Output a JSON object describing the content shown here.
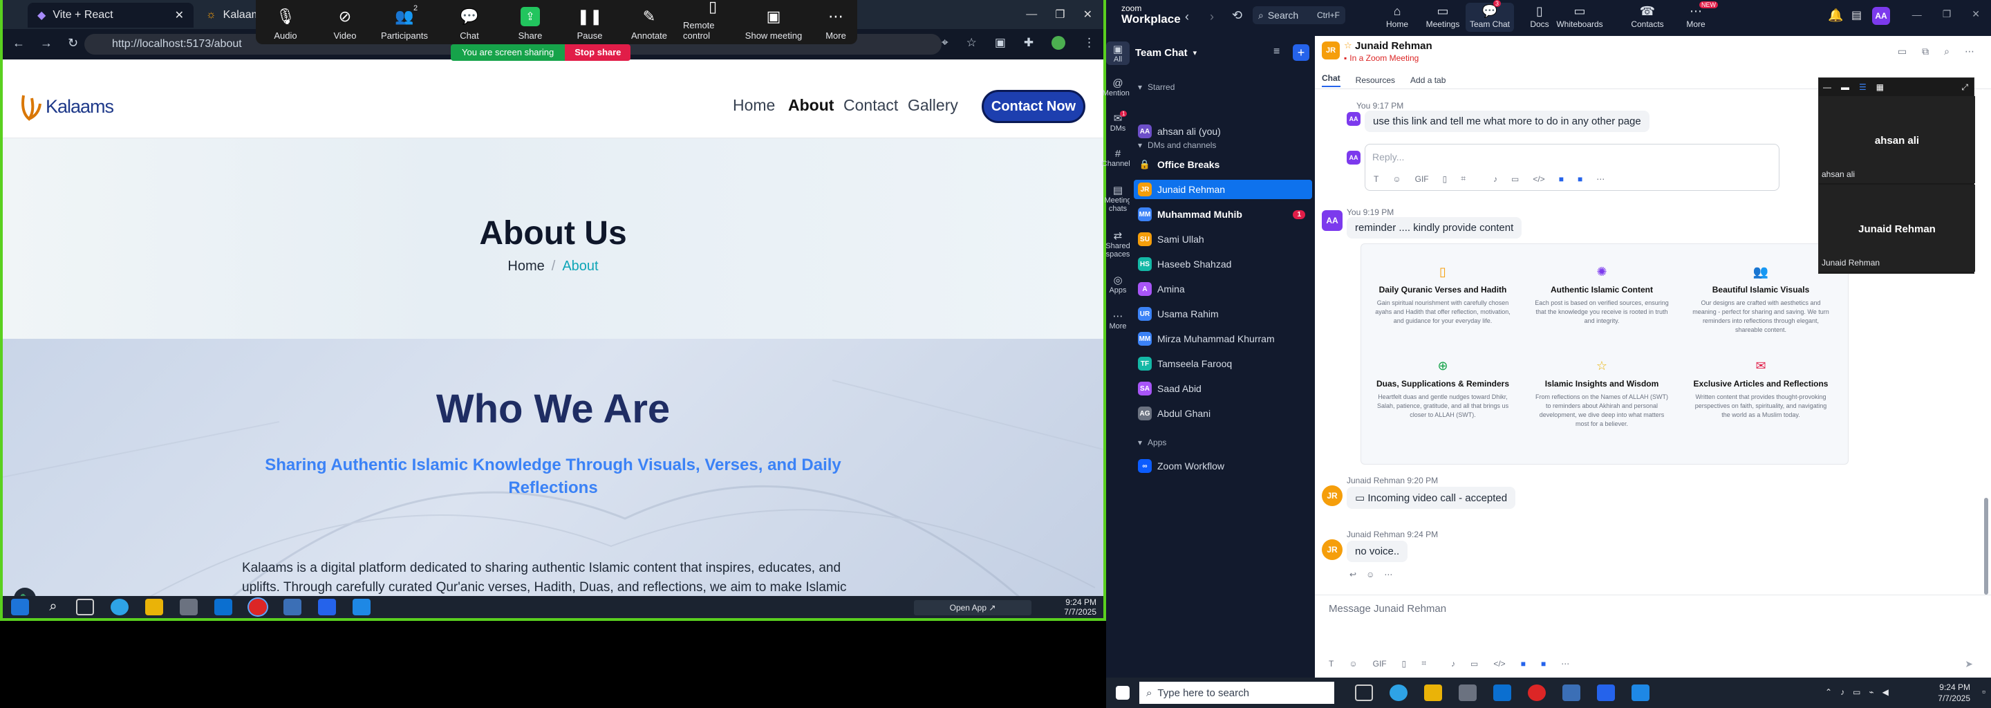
{
  "browser": {
    "tabs": [
      {
        "title": "Vite + React"
      },
      {
        "title": "Kalaams"
      }
    ],
    "url": "http://localhost:5173/about"
  },
  "zoom_toolbar": {
    "items": [
      {
        "label": "Audio",
        "icon": "microphone-icon"
      },
      {
        "label": "Video",
        "icon": "video-off-icon"
      },
      {
        "label": "Participants",
        "icon": "participants-icon",
        "count": "2"
      },
      {
        "label": "Chat",
        "icon": "chat-icon"
      },
      {
        "label": "Share",
        "icon": "share-icon"
      },
      {
        "label": "Pause",
        "icon": "pause-icon"
      },
      {
        "label": "Annotate",
        "icon": "annotate-icon"
      },
      {
        "label": "Remote control",
        "icon": "remote-control-icon"
      },
      {
        "label": "Show meeting",
        "icon": "show-meeting-icon"
      },
      {
        "label": "More",
        "icon": "more-icon"
      }
    ],
    "sharing_text": "You are screen sharing",
    "stop_share": "Stop share"
  },
  "site": {
    "logo": "Kalaams",
    "nav": [
      "Home",
      "About",
      "Contact",
      "Gallery"
    ],
    "active_nav": "About",
    "cta": "Contact Now",
    "hero_title": "About Us",
    "breadcrumb_home": "Home",
    "breadcrumb_sep": "/",
    "breadcrumb_current": "About",
    "who_title": "Who We Are",
    "who_subtitle": "Sharing Authentic Islamic Knowledge Through Visuals, Verses, and Daily Reflections",
    "body_line1": "Kalaams is a digital platform dedicated to sharing authentic Islamic content that inspires, educates, and",
    "body_line2": "uplifts. Through carefully curated Qur'anic verses, Hadith, Duas, and reflections, we aim to make Islamic"
  },
  "left_taskbar": {
    "open_app": "Open App ↗",
    "time": "9:24 PM",
    "date": "7/7/2025"
  },
  "zoom": {
    "brand_top": "zoom",
    "brand": "Workplace",
    "search": "Search",
    "search_shortcut": "Ctrl+F",
    "nav": [
      {
        "label": "Home",
        "icon": "home-icon"
      },
      {
        "label": "Meetings",
        "icon": "meetings-icon"
      },
      {
        "label": "Team Chat",
        "icon": "team-chat-icon",
        "badge": "3"
      },
      {
        "label": "Docs",
        "icon": "docs-icon"
      },
      {
        "label": "Whiteboards",
        "icon": "whiteboards-icon"
      },
      {
        "label": "Contacts",
        "icon": "contacts-icon"
      },
      {
        "label": "More",
        "icon": "more-icon",
        "badge": "NEW"
      }
    ],
    "avatar": "AA",
    "rail": [
      {
        "label": "All"
      },
      {
        "label": "Mentions"
      },
      {
        "label": "DMs",
        "badge": "1"
      },
      {
        "label": "Channels"
      },
      {
        "label": "Meeting chats"
      },
      {
        "label": "Shared spaces"
      },
      {
        "label": "Apps"
      },
      {
        "label": "More"
      }
    ],
    "sidebar_title": "Team Chat",
    "sections": {
      "starred": "Starred",
      "dms": "DMs and channels",
      "apps": "Apps"
    },
    "starred": [
      {
        "name": "ahsan ali (you)",
        "initials": "AA",
        "color": "#6d4fc8"
      }
    ],
    "contacts": [
      {
        "name": "Office Breaks",
        "initials": "",
        "color": "#121a2d",
        "bold": true
      },
      {
        "name": "Junaid Rehman",
        "initials": "JR",
        "color": "#f59e0b",
        "selected": true
      },
      {
        "name": "Muhammad Muhib",
        "initials": "MM",
        "color": "#3b82f6",
        "bold": true,
        "badge": "1"
      },
      {
        "name": "Sami Ullah",
        "initials": "SU",
        "color": "#f59e0b"
      },
      {
        "name": "Haseeb Shahzad",
        "initials": "HS",
        "color": "#14b8a6"
      },
      {
        "name": "Amina",
        "initials": "A",
        "color": "#a855f7"
      },
      {
        "name": "Usama Rahim",
        "initials": "UR",
        "color": "#3b82f6"
      },
      {
        "name": "Mirza Muhammad Khurram",
        "initials": "MM",
        "color": "#3b82f6"
      },
      {
        "name": "Tamseela Farooq",
        "initials": "TF",
        "color": "#14b8a6"
      },
      {
        "name": "Saad Abid",
        "initials": "SA",
        "color": "#a855f7"
      },
      {
        "name": "Abdul Ghani",
        "initials": "AG",
        "color": "#6b7280"
      }
    ],
    "apps": [
      {
        "name": "Zoom Workflow"
      }
    ],
    "chat": {
      "title": "Junaid Rehman",
      "status": "In a Zoom Meeting",
      "tabs": [
        "Chat",
        "Resources",
        "Add a tab"
      ],
      "messages": {
        "m1_meta": "You 9:17 PM",
        "m1_text": "use this link and tell me what more to do in any other page",
        "reply_placeholder": "Reply...",
        "m2_meta": "You 9:19 PM",
        "m2_text": "reminder .... kindly provide content",
        "features": [
          {
            "title": "Daily Quranic Verses and Hadith",
            "text": "Gain spiritual nourishment with carefully chosen ayahs and Hadith that offer reflection, motivation, and guidance for your everyday life."
          },
          {
            "title": "Authentic Islamic Content",
            "text": "Each post is based on verified sources, ensuring that the knowledge you receive is rooted in truth and integrity."
          },
          {
            "title": "Beautiful Islamic Visuals",
            "text": "Our designs are crafted with aesthetics and meaning - perfect for sharing and saving. We turn reminders into reflections through elegant, shareable content."
          },
          {
            "title": "Duas, Supplications & Reminders",
            "text": "Heartfelt duas and gentle nudges toward Dhikr, Salah, patience, gratitude, and all that brings us closer to ALLAH (SWT)."
          },
          {
            "title": "Islamic Insights and Wisdom",
            "text": "From reflections on the Names of ALLAH (SWT) to reminders about Akhirah and personal development, we dive deep into what matters most for a believer."
          },
          {
            "title": "Exclusive Articles and Reflections",
            "text": "Written content that provides thought-provoking perspectives on faith, spirituality, and navigating the world as a Muslim today."
          }
        ],
        "m3_meta": "Junaid Rehman 9:20 PM",
        "m3_text": "Incoming video call - accepted",
        "m4_meta": "Junaid Rehman 9:24 PM",
        "m4_text": "no voice.."
      },
      "composer_placeholder": "Message Junaid Rehman"
    },
    "meeting_panel": {
      "p1": "ahsan ali",
      "p1_label": "ahsan ali",
      "p2": "Junaid Rehman",
      "p2_label": "Junaid Rehman"
    }
  },
  "right_taskbar": {
    "search": "Type here to search",
    "time": "9:24 PM",
    "date": "7/7/2025"
  }
}
